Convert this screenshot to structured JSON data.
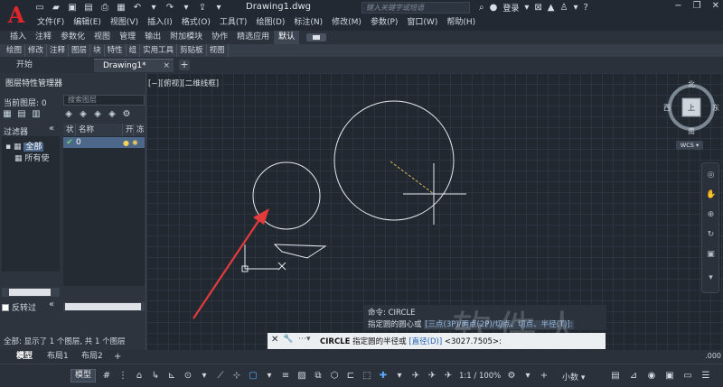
{
  "app": {
    "doc_title": "Drawing1.dwg",
    "search_placeholder": "键入关键字或短语",
    "login": "登录"
  },
  "menus": [
    "文件(F)",
    "编辑(E)",
    "视图(V)",
    "插入(I)",
    "格式(O)",
    "工具(T)",
    "绘图(D)",
    "标注(N)",
    "修改(M)",
    "参数(P)",
    "窗口(W)",
    "帮助(H)"
  ],
  "ribbon_tabs": [
    "插入",
    "注释",
    "参数化",
    "视图",
    "管理",
    "输出",
    "附加模块",
    "协作",
    "精选应用",
    "默认"
  ],
  "ribbon_active": "默认",
  "ribbon_panels": [
    "绘图",
    "修改",
    "注释",
    "图层",
    "块",
    "特性",
    "组",
    "实用工具",
    "剪贴板",
    "视图"
  ],
  "file_tabs": {
    "start": "开始",
    "drawing": "Drawing1*",
    "close": "×",
    "add": "+"
  },
  "layer_palette": {
    "title": "图层特性管理器",
    "current_layer": "当前图层: 0",
    "search_placeholder": "搜索图层",
    "filter_label": "过滤器",
    "tree_all": "全部",
    "tree_used": "所有使",
    "invert": "反转过",
    "columns": [
      "状",
      "名称",
      "开",
      "冻"
    ],
    "layers": [
      {
        "name": "0",
        "current": true
      }
    ],
    "status": "全部: 显示了 1 个图层, 共 1 个图层"
  },
  "viewport_label": "[−][俯视][二维线框]",
  "viewcube": {
    "north": "北",
    "south": "南",
    "west": "西",
    "east": "东",
    "top": "上",
    "wcs": "WCS"
  },
  "command": {
    "history_line1": "命令:  CIRCLE",
    "history_line2_a": "指定圆的圆心或 ",
    "history_line2_b": "[三点(3P)/两点(2P)/切点、切点、半径(T)]:",
    "prompt_cmd": "CIRCLE",
    "prompt_text": " 指定圆的半径或 ",
    "prompt_option": "[直径(D)]",
    "prompt_value": " <3027.7505>:"
  },
  "layout_tabs": {
    "model": "模型",
    "layout1": "布局1",
    "layout2": "布局2",
    "add": "+",
    "coord": ".000"
  },
  "statusbar": {
    "model": "模型",
    "scale": "1:1 / 100%",
    "decimal": "小数"
  },
  "watermark": "软件人",
  "icons": {
    "qat": [
      "new-icon",
      "open-icon",
      "save-icon",
      "saveas-icon",
      "print-icon",
      "undo-icon",
      "redo-icon",
      "share-icon"
    ],
    "status": [
      "grid-icon",
      "snap-icon",
      "infer-icon",
      "dynamic-input-icon",
      "ortho-icon",
      "polar-icon",
      "isodraft-icon",
      "object-snap-tracking-icon",
      "object-snap-icon",
      "lineweight-icon",
      "transparency-icon",
      "selection-cycling-icon",
      "3d-osnap-icon",
      "dynamic-ucs-icon",
      "selection-filter-icon",
      "gizmo-icon",
      "annotation-visibility-icon",
      "auto-scale-icon"
    ]
  },
  "colors": {
    "background": "#212830",
    "accent": "#5aa8ff",
    "brand": "#e0262b"
  }
}
